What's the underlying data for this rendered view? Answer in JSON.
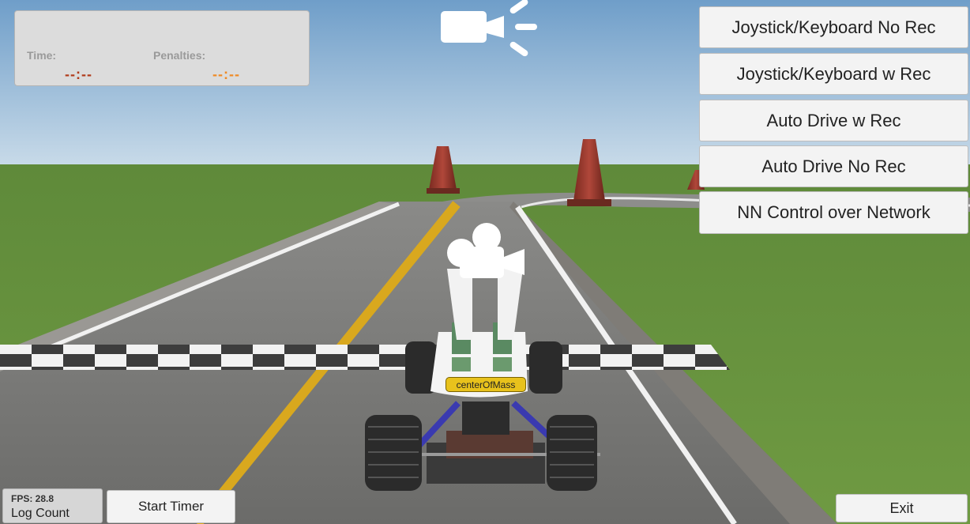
{
  "hud": {
    "time_label": "Time:",
    "time_value": "--:--",
    "penalties_label": "Penalties:",
    "penalties_value": "--:--",
    "time_color": "#b13a1a",
    "penalties_color": "#f08a24"
  },
  "menu": {
    "buttons": [
      {
        "label": "Joystick/Keyboard No Rec"
      },
      {
        "label": "Joystick/Keyboard w Rec"
      },
      {
        "label": "Auto Drive w Rec"
      },
      {
        "label": "Auto Drive No Rec"
      },
      {
        "label": "NN Control over Network"
      }
    ]
  },
  "stats": {
    "fps_label": "FPS: 28.8",
    "log_count_label": "Log Count"
  },
  "controls": {
    "start_timer_label": "Start Timer",
    "exit_label": "Exit"
  },
  "scene": {
    "center_of_mass_label": "centerOfMass",
    "icons": [
      "camera-icon",
      "camera-icon"
    ]
  }
}
